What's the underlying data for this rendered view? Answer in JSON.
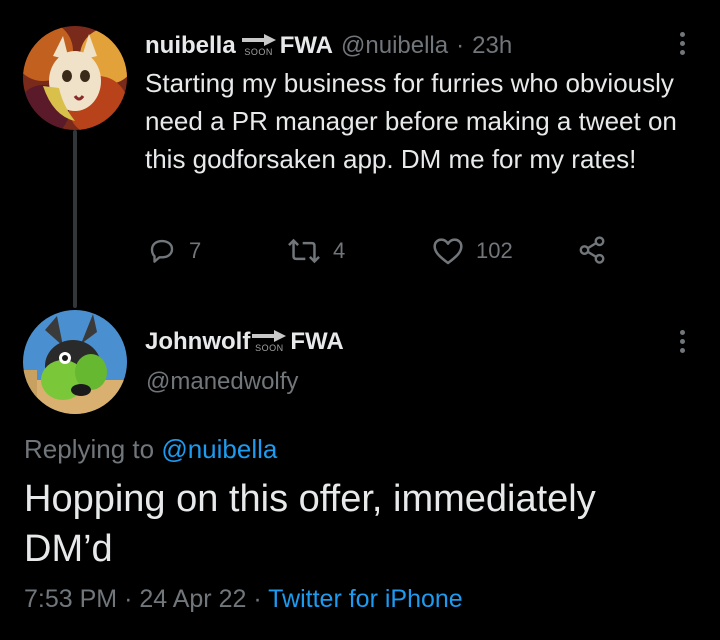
{
  "parent_tweet": {
    "display_name": "nuibella",
    "soon_label": "SOON",
    "name_suffix": "FWA",
    "handle": "@nuibella",
    "separator": "·",
    "time_ago": "23h",
    "text": "Starting my business for furries who obviously need a PR manager before making a tweet on this godforsaken app. DM me for my rates!",
    "actions": {
      "reply_count": "7",
      "retweet_count": "4",
      "like_count": "102"
    }
  },
  "main_tweet": {
    "display_name": "Johnwolf",
    "soon_label": "SOON",
    "name_suffix": "FWA",
    "handle": "@manedwolfy",
    "replying_prefix": "Replying to",
    "replying_handle": "@nuibella",
    "text": "Hopping on this offer, immediately DM’d",
    "time": "7:53 PM",
    "separator": "·",
    "date": "24 Apr 22",
    "separator2": "·",
    "source": "Twitter for iPhone"
  },
  "colors": {
    "background": "#000000",
    "text": "#e7e9ea",
    "muted": "#71767b",
    "link": "#1d9bf0",
    "thread_line": "#333639"
  },
  "icons": [
    "reply-icon",
    "retweet-icon",
    "like-icon",
    "share-icon",
    "more-icon",
    "arrow-icon"
  ]
}
